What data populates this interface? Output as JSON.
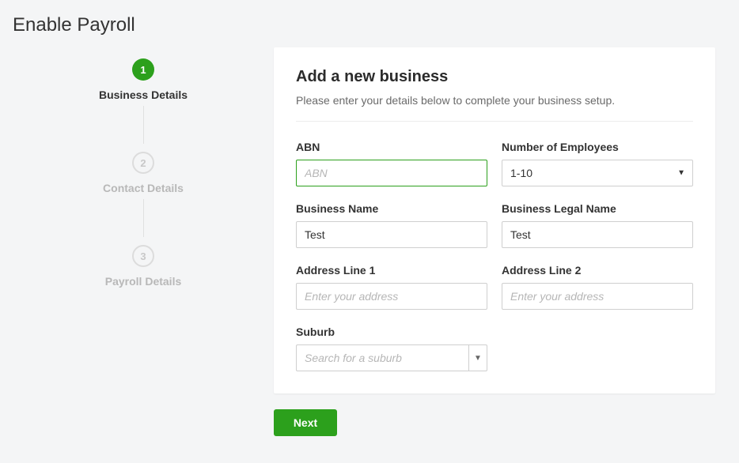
{
  "page": {
    "title": "Enable Payroll"
  },
  "steps": [
    {
      "number": "1",
      "label": "Business Details",
      "active": true
    },
    {
      "number": "2",
      "label": "Contact Details",
      "active": false
    },
    {
      "number": "3",
      "label": "Payroll Details",
      "active": false
    }
  ],
  "card": {
    "title": "Add a new business",
    "subtitle": "Please enter your details below to complete your business setup."
  },
  "fields": {
    "abn": {
      "label": "ABN",
      "placeholder": "ABN",
      "value": ""
    },
    "employees": {
      "label": "Number of Employees",
      "value": "1-10"
    },
    "business_name": {
      "label": "Business Name",
      "value": "Test",
      "placeholder": ""
    },
    "legal_name": {
      "label": "Business Legal Name",
      "value": "Test",
      "placeholder": ""
    },
    "address1": {
      "label": "Address Line 1",
      "placeholder": "Enter your address",
      "value": ""
    },
    "address2": {
      "label": "Address Line 2",
      "placeholder": "Enter your address",
      "value": ""
    },
    "suburb": {
      "label": "Suburb",
      "placeholder": "Search for a suburb",
      "value": ""
    }
  },
  "actions": {
    "next": "Next"
  }
}
